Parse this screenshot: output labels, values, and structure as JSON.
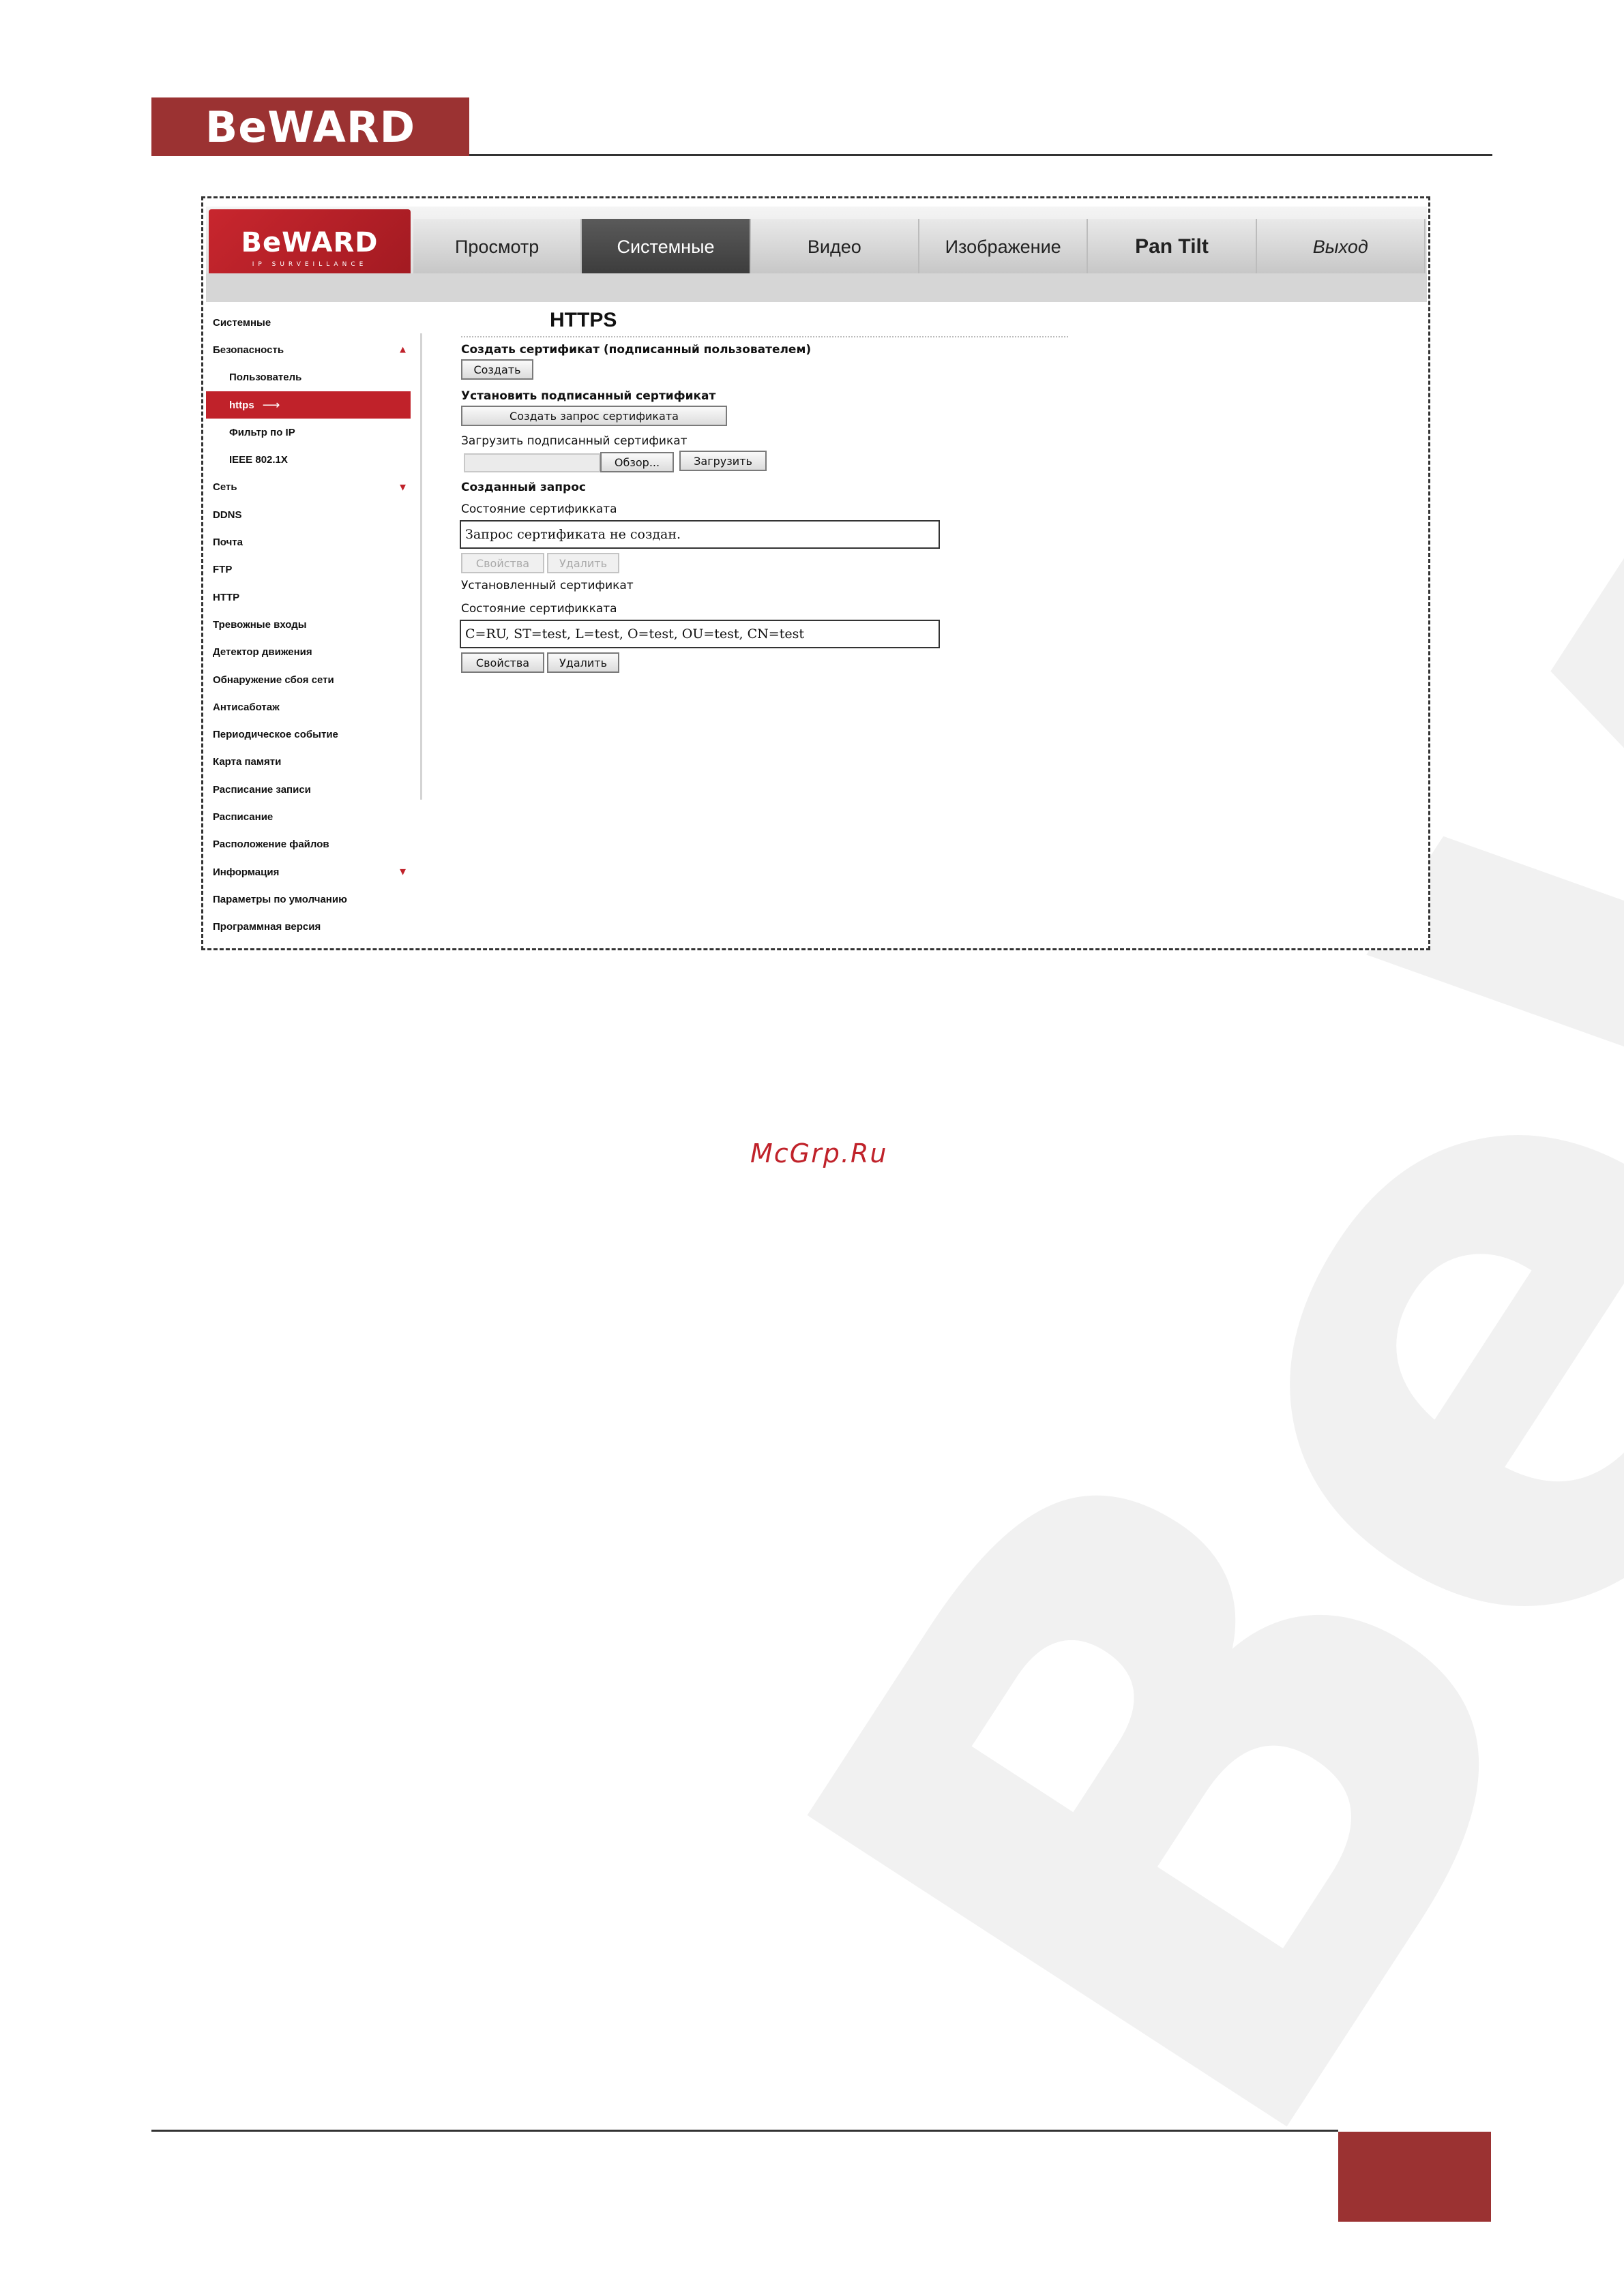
{
  "brand": {
    "doc_logo": "BeWARD",
    "app_logo": "BeWARD",
    "app_logo_tagline": "IP SURVEILLANCE",
    "watermark": "BeWARD",
    "accent_color": "#c0222a",
    "dark_red": "#9b3232"
  },
  "nav": {
    "items": [
      "Просмотр",
      "Системные",
      "Видео",
      "Изображение",
      "Pan Tilt",
      "Выход"
    ],
    "active": "Системные"
  },
  "sidebar": {
    "items": [
      {
        "label": "Системные"
      },
      {
        "label": "Безопасность",
        "arrow": "▲"
      },
      {
        "label": "Пользователь"
      },
      {
        "label": "https",
        "active": true,
        "marker": "⟶"
      },
      {
        "label": "Фильтр по IP"
      },
      {
        "label": "IEEE 802.1X"
      },
      {
        "label": "Сеть",
        "arrow": "▼"
      },
      {
        "label": "DDNS"
      },
      {
        "label": "Почта"
      },
      {
        "label": "FTP"
      },
      {
        "label": "HTTP"
      },
      {
        "label": "Тревожные входы"
      },
      {
        "label": "Детектор движения"
      },
      {
        "label": "Обнаружение сбоя сети"
      },
      {
        "label": "Антисаботаж"
      },
      {
        "label": "Периодическое событие"
      },
      {
        "label": "Карта памяти"
      },
      {
        "label": "Расписание записи"
      },
      {
        "label": "Расписание"
      },
      {
        "label": "Расположение файлов"
      },
      {
        "label": "Информация",
        "arrow": "▼"
      },
      {
        "label": "Параметры по умолчанию"
      },
      {
        "label": "Программная версия"
      }
    ]
  },
  "content": {
    "title": "HTTPS",
    "create_cert_heading": "Создать сертификат (подписанный пользователем)",
    "create_button": "Создать",
    "install_signed_heading": "Установить подписанный сертификат",
    "create_request_button": "Создать запрос сертификата",
    "upload_signed_label": "Загрузить подписанный сертификат",
    "browse_button": "Обзор...",
    "upload_button": "Загрузить",
    "created_request_heading": "Созданный запрос",
    "cert_status_label_1": "Состояние сертификката",
    "request_status_value": "Запрос сертификата не создан.",
    "properties_button_1": "Свойства",
    "delete_button_1": "Удалить",
    "installed_cert_label": "Установленный сертификат",
    "cert_status_label_2": "Состояние сертификката",
    "installed_cert_value": "C=RU, ST=test, L=test, O=test, OU=test, CN=test",
    "properties_button_2": "Свойства",
    "delete_button_2": "Удалить"
  },
  "footer": {
    "site_mark": "McGrp.Ru"
  }
}
